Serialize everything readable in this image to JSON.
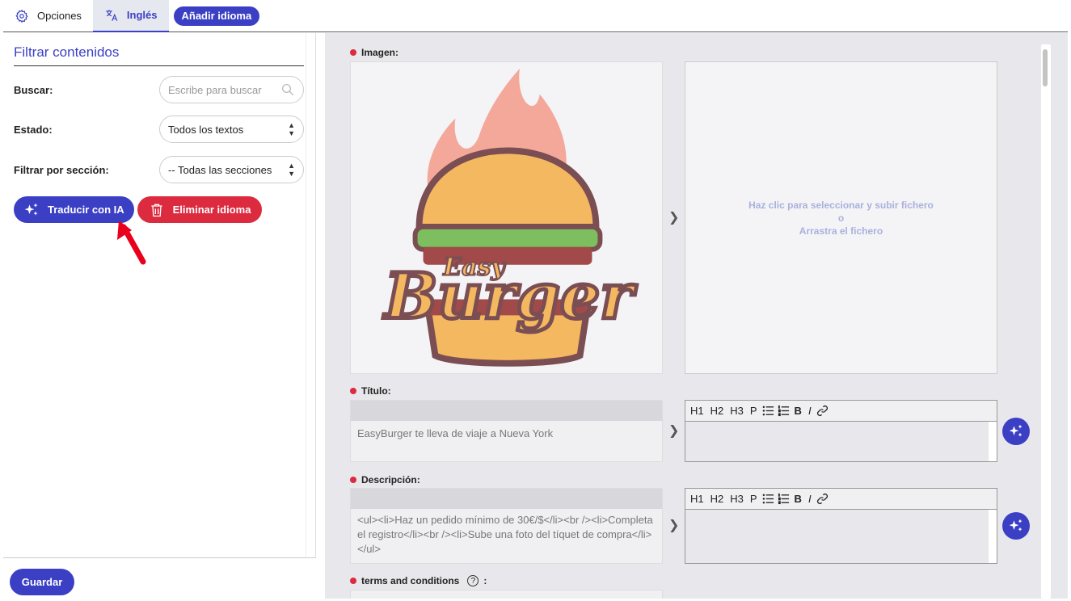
{
  "tabs": {
    "options_label": "Opciones",
    "language_label": "Inglés",
    "add_language_label": "Añadir idioma"
  },
  "filter": {
    "title": "Filtrar contenidos",
    "search_label": "Buscar:",
    "search_placeholder": "Escribe para buscar",
    "status_label": "Estado:",
    "status_value": "Todos los textos",
    "section_label": "Filtrar por sección:",
    "section_value": "-- Todas las secciones"
  },
  "actions": {
    "translate_ai": "Traducir con IA",
    "delete_language": "Eliminar idioma",
    "save": "Guardar"
  },
  "fields": {
    "image": {
      "label": "Imagen:",
      "logo_line1": "Easy",
      "logo_line2": "Burger",
      "drop_line1": "Haz clic para seleccionar y subir fichero",
      "drop_line2": "o",
      "drop_line3": "Arrastra el fichero"
    },
    "title": {
      "label": "Título:",
      "source": "EasyBurger te lleva de viaje a Nueva York"
    },
    "description": {
      "label": "Descripción:",
      "source": "<ul><li>Haz un pedido mínimo de 30€/$</li><br /><li>Completa el registro</li><br /><li>Sube una foto del tíquet de compra</li></ul>"
    },
    "terms": {
      "label": "terms and conditions",
      "help": "?",
      "colon": ":"
    }
  },
  "toolbar": {
    "h1": "H1",
    "h2": "H2",
    "h3": "H3",
    "p": "P",
    "bold": "B",
    "italic": "I"
  },
  "colors": {
    "accent": "#3b3fc4",
    "danger": "#dc2a3f"
  }
}
